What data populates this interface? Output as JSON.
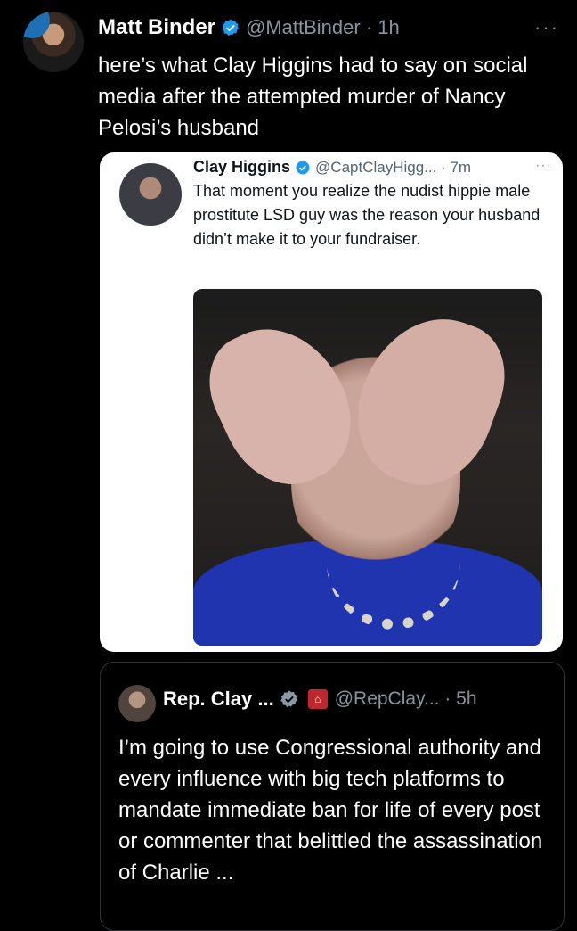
{
  "tweet": {
    "author_name": "Matt Binder",
    "author_handle": "@MattBinder · 1h",
    "more": "···",
    "text": "here’s what Clay Higgins had to say on social media after the attempted murder of Nancy Pelosi’s husband"
  },
  "embedded_screenshot": {
    "author_name": "Clay Higgins",
    "author_handle": "@CaptClayHigg... · 7m",
    "more": "···",
    "text": "That moment you realize the nudist hippie male prostitute LSD guy was the reason your husband didn’t make it to your fundraiser."
  },
  "quoted_tweet": {
    "author_name": "Rep. Clay ...",
    "author_handle": "@RepClay... · 5h",
    "text": "I’m going to use Congressional authority and every influence with big tech platforms to mandate immediate ban for life of every post or commenter that belittled the assassination of Charlie ..."
  },
  "colors": {
    "verified": "#1d9bf0",
    "background": "#000000"
  }
}
